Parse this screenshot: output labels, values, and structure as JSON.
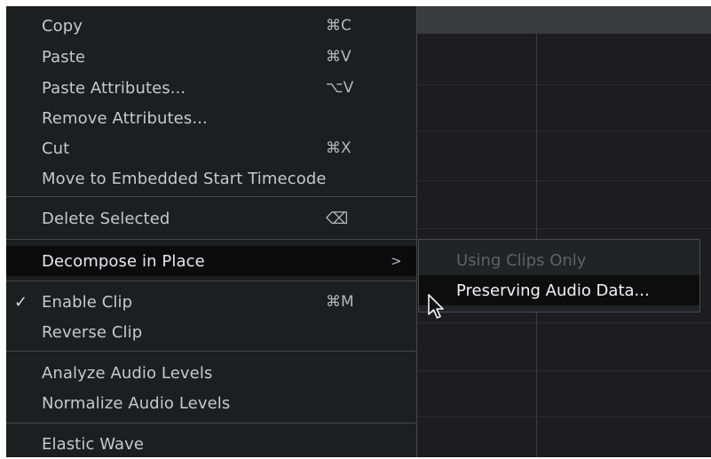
{
  "context_menu": {
    "items": [
      {
        "label": "Copy",
        "shortcut": "⌘C"
      },
      {
        "label": "Paste",
        "shortcut": "⌘V"
      },
      {
        "label": "Paste Attributes...",
        "shortcut": "⌥V"
      },
      {
        "label": "Remove Attributes...",
        "shortcut": ""
      },
      {
        "label": "Cut",
        "shortcut": "⌘X"
      },
      {
        "label": "Move to Embedded Start Timecode",
        "shortcut": ""
      },
      {
        "label": "Delete Selected",
        "shortcut": "⌫"
      },
      {
        "label": "Decompose in Place",
        "shortcut": "",
        "submenu_indicator": ">"
      },
      {
        "label": "Enable Clip",
        "shortcut": "⌘M",
        "checked": true,
        "check_mark": "✓"
      },
      {
        "label": "Reverse Clip",
        "shortcut": ""
      },
      {
        "label": "Analyze Audio Levels",
        "shortcut": ""
      },
      {
        "label": "Normalize Audio Levels",
        "shortcut": ""
      },
      {
        "label": "Elastic Wave",
        "shortcut": ""
      }
    ]
  },
  "submenu": {
    "items": [
      {
        "label": "Using Clips Only",
        "state": "disabled"
      },
      {
        "label": "Preserving Audio Data...",
        "state": "highlighted"
      }
    ]
  },
  "icons": {
    "cursor": "mouse-pointer-icon",
    "check": "checkmark-icon",
    "submenu_arrow": "chevron-right-icon",
    "delete_key": "delete-key-icon"
  },
  "colors": {
    "menu_bg": "#1d1e20",
    "highlight_bg": "#0b0b0c",
    "text": "#c6c8cc",
    "disabled_text": "#5f6166",
    "separator": "#46474a"
  }
}
